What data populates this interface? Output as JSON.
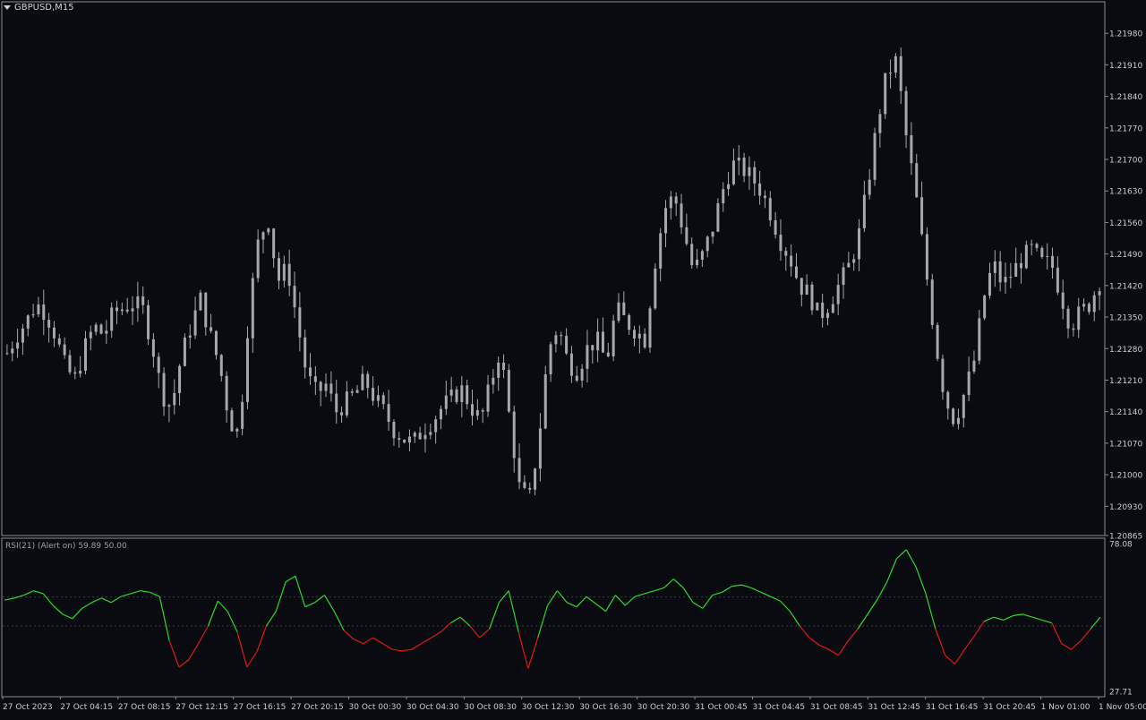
{
  "window": {
    "symbol_label": "GBPUSD,M15",
    "indicator_label": "RSI(21) (Alert on) 59.89 50.00"
  },
  "chart_data": [
    {
      "type": "candlestick",
      "title": "GBPUSD,M15",
      "ylim": [
        1.20865,
        1.2205
      ],
      "y_ticks": [
        "1.21980",
        "1.21910",
        "1.21840",
        "1.21770",
        "1.21700",
        "1.21630",
        "1.21560",
        "1.21490",
        "1.21420",
        "1.21350",
        "1.21280",
        "1.21210",
        "1.21140",
        "1.21070",
        "1.21000",
        "1.20930",
        "1.20865"
      ],
      "x_ticks": [
        "27 Oct 2023",
        "27 Oct 04:15",
        "27 Oct 08:15",
        "27 Oct 12:15",
        "27 Oct 16:15",
        "27 Oct 20:15",
        "30 Oct 00:30",
        "30 Oct 04:30",
        "30 Oct 08:30",
        "30 Oct 12:30",
        "30 Oct 16:30",
        "30 Oct 20:30",
        "31 Oct 00:45",
        "31 Oct 04:45",
        "31 Oct 08:45",
        "31 Oct 12:45",
        "31 Oct 16:45",
        "31 Oct 20:45",
        "1 Nov 01:00",
        "1 Nov 05:00"
      ],
      "close_path": [
        1.2127,
        1.2131,
        1.2134,
        1.2138,
        1.2136,
        1.2131,
        1.2124,
        1.2121,
        1.2128,
        1.2133,
        1.2131,
        1.2136,
        1.2137,
        1.2138,
        1.2137,
        1.2129,
        1.2118,
        1.2115,
        1.2126,
        1.2133,
        1.2139,
        1.2131,
        1.2124,
        1.2112,
        1.2109,
        1.2136,
        1.2152,
        1.2157,
        1.2143,
        1.2146,
        1.2134,
        1.2122,
        1.2118,
        1.212,
        1.2114,
        1.2116,
        1.2118,
        1.2121,
        1.2117,
        1.2114,
        1.211,
        1.2108,
        1.2107,
        1.211,
        1.2112,
        1.2115,
        1.2117,
        1.2119,
        1.2115,
        1.2112,
        1.212,
        1.2128,
        1.2112,
        1.2097,
        1.2094,
        1.2108,
        1.2128,
        1.2133,
        1.2125,
        1.2123,
        1.2128,
        1.213,
        1.2125,
        1.2137,
        1.2134,
        1.2132,
        1.213,
        1.2147,
        1.2159,
        1.2162,
        1.2154,
        1.2145,
        1.2149,
        1.2155,
        1.2163,
        1.2169,
        1.2168,
        1.2166,
        1.2163,
        1.2158,
        1.2152,
        1.2148,
        1.2142,
        1.214,
        1.2135,
        1.2138,
        1.2142,
        1.2146,
        1.2152,
        1.2164,
        1.2178,
        1.2189,
        1.2192,
        1.2175,
        1.2162,
        1.2146,
        1.213,
        1.2117,
        1.2112,
        1.2118,
        1.2125,
        1.2139,
        1.2147,
        1.2142,
        1.2145,
        1.2148,
        1.215,
        1.2147,
        1.2147,
        1.214,
        1.2133,
        1.2136,
        1.2138,
        1.2143
      ],
      "series_color": "#a6a8ad"
    },
    {
      "type": "line",
      "title": "RSI(21) (Alert on) 59.89 50.00",
      "ylim": [
        27.71,
        78.08
      ],
      "y_ticks": [
        "78.08",
        "27.71"
      ],
      "levels": [
        59.89,
        50.0
      ],
      "values": [
        58.8,
        59.5,
        60.5,
        62.0,
        61.0,
        57.0,
        54.0,
        52.5,
        56.0,
        58.0,
        59.5,
        58.0,
        60.0,
        61.0,
        62.0,
        61.5,
        60.0,
        45.0,
        36.0,
        38.5,
        44.0,
        50.0,
        58.5,
        55.0,
        48.0,
        36.0,
        41.0,
        50.0,
        55.0,
        65.0,
        67.0,
        56.5,
        58.0,
        60.5,
        55.0,
        48.5,
        45.5,
        44.0,
        46.0,
        44.0,
        42.0,
        41.5,
        42.0,
        44.0,
        46.0,
        48.0,
        51.0,
        53.0,
        50.0,
        46.0,
        49.0,
        58.0,
        62.0,
        48.0,
        35.5,
        46.0,
        57.0,
        62.0,
        58.0,
        56.5,
        60.0,
        57.5,
        55.0,
        60.5,
        57.0,
        60.0,
        61.0,
        62.0,
        63.0,
        66.0,
        63.0,
        58.0,
        56.0,
        60.5,
        61.5,
        63.5,
        64.0,
        63.0,
        61.5,
        60.0,
        58.5,
        55.0,
        50.0,
        46.0,
        43.5,
        42.0,
        40.0,
        45.0,
        49.0,
        54.0,
        59.0,
        65.0,
        73.0,
        76.0,
        70.0,
        61.0,
        49.0,
        40.0,
        37.0,
        42.0,
        46.5,
        51.5,
        53.0,
        52.0,
        53.5,
        54.0,
        53.0,
        52.0,
        51.0,
        44.0,
        42.0,
        45.0,
        49.0,
        53.0
      ],
      "color_above": "#2ed62e",
      "color_below": "#e01818"
    }
  ]
}
